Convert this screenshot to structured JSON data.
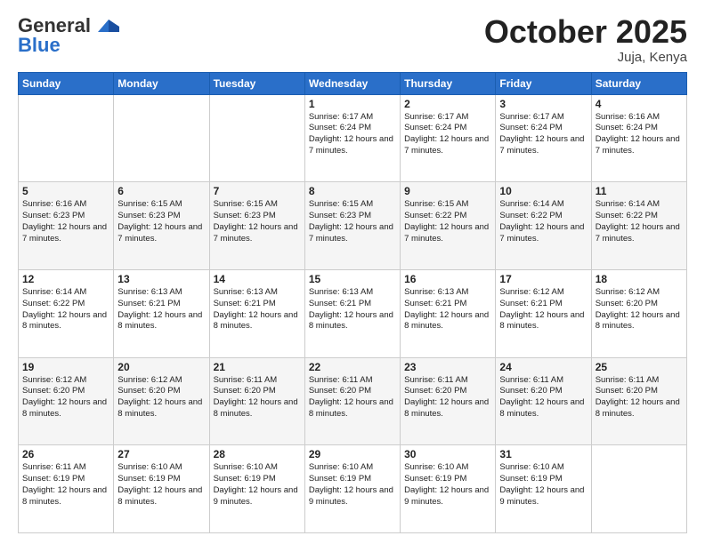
{
  "logo": {
    "general": "General",
    "blue": "Blue"
  },
  "header": {
    "month": "October 2025",
    "location": "Juja, Kenya"
  },
  "days_of_week": [
    "Sunday",
    "Monday",
    "Tuesday",
    "Wednesday",
    "Thursday",
    "Friday",
    "Saturday"
  ],
  "weeks": [
    [
      {
        "day": "",
        "content": ""
      },
      {
        "day": "",
        "content": ""
      },
      {
        "day": "",
        "content": ""
      },
      {
        "day": "1",
        "content": "Sunrise: 6:17 AM\nSunset: 6:24 PM\nDaylight: 12 hours and 7 minutes."
      },
      {
        "day": "2",
        "content": "Sunrise: 6:17 AM\nSunset: 6:24 PM\nDaylight: 12 hours and 7 minutes."
      },
      {
        "day": "3",
        "content": "Sunrise: 6:17 AM\nSunset: 6:24 PM\nDaylight: 12 hours and 7 minutes."
      },
      {
        "day": "4",
        "content": "Sunrise: 6:16 AM\nSunset: 6:24 PM\nDaylight: 12 hours and 7 minutes."
      }
    ],
    [
      {
        "day": "5",
        "content": "Sunrise: 6:16 AM\nSunset: 6:23 PM\nDaylight: 12 hours and 7 minutes."
      },
      {
        "day": "6",
        "content": "Sunrise: 6:15 AM\nSunset: 6:23 PM\nDaylight: 12 hours and 7 minutes."
      },
      {
        "day": "7",
        "content": "Sunrise: 6:15 AM\nSunset: 6:23 PM\nDaylight: 12 hours and 7 minutes."
      },
      {
        "day": "8",
        "content": "Sunrise: 6:15 AM\nSunset: 6:23 PM\nDaylight: 12 hours and 7 minutes."
      },
      {
        "day": "9",
        "content": "Sunrise: 6:15 AM\nSunset: 6:22 PM\nDaylight: 12 hours and 7 minutes."
      },
      {
        "day": "10",
        "content": "Sunrise: 6:14 AM\nSunset: 6:22 PM\nDaylight: 12 hours and 7 minutes."
      },
      {
        "day": "11",
        "content": "Sunrise: 6:14 AM\nSunset: 6:22 PM\nDaylight: 12 hours and 7 minutes."
      }
    ],
    [
      {
        "day": "12",
        "content": "Sunrise: 6:14 AM\nSunset: 6:22 PM\nDaylight: 12 hours and 8 minutes."
      },
      {
        "day": "13",
        "content": "Sunrise: 6:13 AM\nSunset: 6:21 PM\nDaylight: 12 hours and 8 minutes."
      },
      {
        "day": "14",
        "content": "Sunrise: 6:13 AM\nSunset: 6:21 PM\nDaylight: 12 hours and 8 minutes."
      },
      {
        "day": "15",
        "content": "Sunrise: 6:13 AM\nSunset: 6:21 PM\nDaylight: 12 hours and 8 minutes."
      },
      {
        "day": "16",
        "content": "Sunrise: 6:13 AM\nSunset: 6:21 PM\nDaylight: 12 hours and 8 minutes."
      },
      {
        "day": "17",
        "content": "Sunrise: 6:12 AM\nSunset: 6:21 PM\nDaylight: 12 hours and 8 minutes."
      },
      {
        "day": "18",
        "content": "Sunrise: 6:12 AM\nSunset: 6:20 PM\nDaylight: 12 hours and 8 minutes."
      }
    ],
    [
      {
        "day": "19",
        "content": "Sunrise: 6:12 AM\nSunset: 6:20 PM\nDaylight: 12 hours and 8 minutes."
      },
      {
        "day": "20",
        "content": "Sunrise: 6:12 AM\nSunset: 6:20 PM\nDaylight: 12 hours and 8 minutes."
      },
      {
        "day": "21",
        "content": "Sunrise: 6:11 AM\nSunset: 6:20 PM\nDaylight: 12 hours and 8 minutes."
      },
      {
        "day": "22",
        "content": "Sunrise: 6:11 AM\nSunset: 6:20 PM\nDaylight: 12 hours and 8 minutes."
      },
      {
        "day": "23",
        "content": "Sunrise: 6:11 AM\nSunset: 6:20 PM\nDaylight: 12 hours and 8 minutes."
      },
      {
        "day": "24",
        "content": "Sunrise: 6:11 AM\nSunset: 6:20 PM\nDaylight: 12 hours and 8 minutes."
      },
      {
        "day": "25",
        "content": "Sunrise: 6:11 AM\nSunset: 6:20 PM\nDaylight: 12 hours and 8 minutes."
      }
    ],
    [
      {
        "day": "26",
        "content": "Sunrise: 6:11 AM\nSunset: 6:19 PM\nDaylight: 12 hours and 8 minutes."
      },
      {
        "day": "27",
        "content": "Sunrise: 6:10 AM\nSunset: 6:19 PM\nDaylight: 12 hours and 8 minutes."
      },
      {
        "day": "28",
        "content": "Sunrise: 6:10 AM\nSunset: 6:19 PM\nDaylight: 12 hours and 9 minutes."
      },
      {
        "day": "29",
        "content": "Sunrise: 6:10 AM\nSunset: 6:19 PM\nDaylight: 12 hours and 9 minutes."
      },
      {
        "day": "30",
        "content": "Sunrise: 6:10 AM\nSunset: 6:19 PM\nDaylight: 12 hours and 9 minutes."
      },
      {
        "day": "31",
        "content": "Sunrise: 6:10 AM\nSunset: 6:19 PM\nDaylight: 12 hours and 9 minutes."
      },
      {
        "day": "",
        "content": ""
      }
    ]
  ]
}
